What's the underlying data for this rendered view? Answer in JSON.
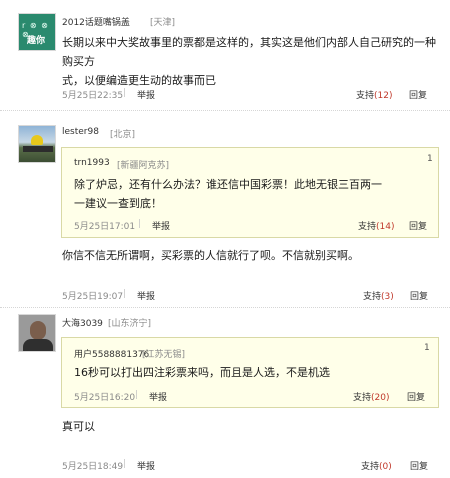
{
  "comments": [
    {
      "avatar_badge": "趣你",
      "user": "2012话题嘴锅盖",
      "location": "[天津]",
      "text_lines": [
        "长期以来中大奖故事里的票都是这样的，其实这是他们内部人自己研究的一种购买方",
        "式，以便编造更生动的故事而已"
      ],
      "time": "5月25日22:35",
      "report": "举报",
      "support": "支持",
      "support_count": "(12)",
      "reply": "回复"
    },
    {
      "user": "lester98",
      "location": "[北京]",
      "quote": {
        "user": "trn1993",
        "location": "[新疆阿克苏]",
        "index": "1",
        "text_lines": [
          "除了炉忌，还有什么办法？谁还信中国彩票！此地无银三百两一",
          "一建议一查到底！"
        ],
        "time": "5月25日17:01",
        "report": "举报",
        "support": "支持",
        "support_count": "(14)",
        "reply": "回复"
      },
      "text": "你信不信无所谓啊，买彩票的人信就行了呗。不信就别买啊。",
      "time": "5月25日19:07",
      "report": "举报",
      "support": "支持",
      "support_count": "(3)",
      "reply": "回复"
    },
    {
      "user": "大海3039",
      "location": "[山东济宁]",
      "quote": {
        "user": "用户5588881376",
        "location": "[江苏无锡]",
        "index": "1",
        "text": "16秒可以打出四注彩票来吗，而且是人选，不是机选",
        "time": "5月25日16:20",
        "report": "举报",
        "support": "支持",
        "support_count": "(20)",
        "reply": "回复"
      },
      "text": "真可以",
      "time": "5月25日18:49",
      "report": "举报",
      "support": "支持",
      "support_count": "(0)",
      "reply": "回复"
    }
  ],
  "separator": "|"
}
